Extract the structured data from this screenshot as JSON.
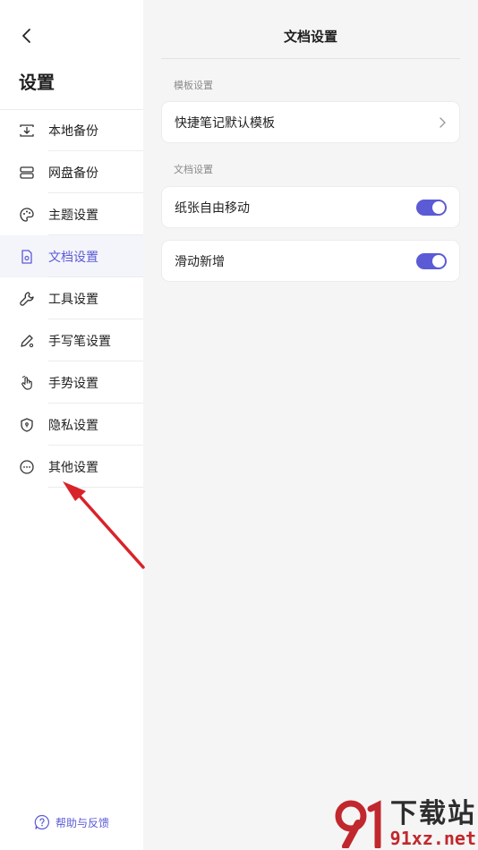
{
  "sidebar": {
    "title": "设置",
    "items": [
      {
        "label": "本地备份",
        "icon": "local-backup-icon"
      },
      {
        "label": "网盘备份",
        "icon": "cloud-backup-icon"
      },
      {
        "label": "主题设置",
        "icon": "palette-icon"
      },
      {
        "label": "文档设置",
        "icon": "document-settings-icon",
        "active": true
      },
      {
        "label": "工具设置",
        "icon": "wrench-icon"
      },
      {
        "label": "手写笔设置",
        "icon": "pen-icon"
      },
      {
        "label": "手势设置",
        "icon": "hand-gesture-icon"
      },
      {
        "label": "隐私设置",
        "icon": "shield-icon"
      },
      {
        "label": "其他设置",
        "icon": "more-icon"
      }
    ],
    "help_label": "帮助与反馈"
  },
  "main": {
    "title": "文档设置",
    "sections": [
      {
        "label": "模板设置",
        "rows": [
          {
            "label": "快捷笔记默认模板",
            "control": "chevron"
          }
        ]
      },
      {
        "label": "文档设置",
        "rows": [
          {
            "label": "纸张自由移动",
            "control": "toggle",
            "on": true
          },
          {
            "label": "滑动新增",
            "control": "toggle",
            "on": true
          }
        ]
      }
    ]
  },
  "watermark": {
    "line1": "下载站",
    "line2": "91xz.net"
  },
  "colors": {
    "accent": "#5b5bd6",
    "arrow": "#d9232b",
    "background": "#f5f5f5"
  }
}
